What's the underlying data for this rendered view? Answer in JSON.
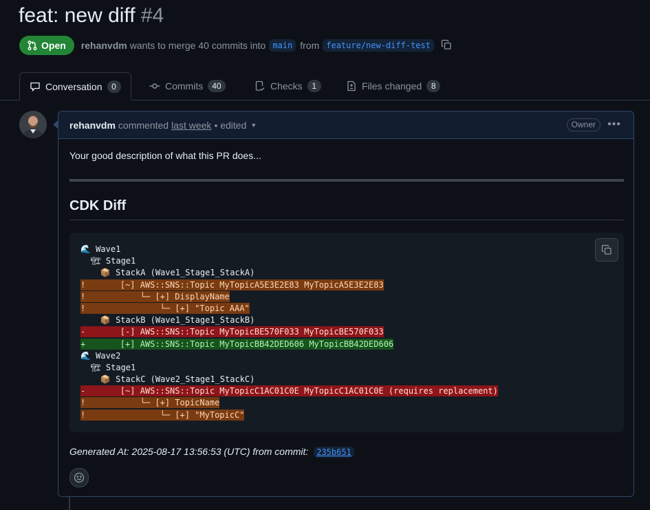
{
  "pr": {
    "title": "feat: new diff",
    "number": "#4",
    "state": "Open",
    "author": "rehanvdm",
    "merge_text": "wants to merge 40 commits into",
    "base_branch": "main",
    "from_text": "from",
    "head_branch": "feature/new-diff-test"
  },
  "tabs": [
    {
      "label": "Conversation",
      "count": "0",
      "icon": "comment-icon"
    },
    {
      "label": "Commits",
      "count": "40",
      "icon": "commit-icon"
    },
    {
      "label": "Checks",
      "count": "1",
      "icon": "checklist-icon"
    },
    {
      "label": "Files changed",
      "count": "8",
      "icon": "file-diff-icon"
    }
  ],
  "comment": {
    "author": "rehanvdm",
    "action": "commented",
    "when": "last week",
    "edited": "• edited",
    "role": "Owner",
    "description": "Your good description of what this PR does...",
    "heading": "CDK Diff",
    "code_lines": [
      {
        "text": "🌊 Wave1",
        "type": "plain"
      },
      {
        "text": "  🏗 Stage1",
        "type": "plain"
      },
      {
        "text": "    📦 StackA (Wave1_Stage1_StackA)",
        "type": "plain"
      },
      {
        "text": "!       [~] AWS::SNS::Topic MyTopicA5E3E2E83 MyTopicA5E3E2E83",
        "type": "warn"
      },
      {
        "text": "!           └─ [+] DisplayName",
        "type": "warn"
      },
      {
        "text": "!               └─ [+] \"Topic AAA\"",
        "type": "warn"
      },
      {
        "text": "    📦 StackB (Wave1_Stage1_StackB)",
        "type": "plain"
      },
      {
        "text": "-       [-] AWS::SNS::Topic MyTopicBE570F033 MyTopicBE570F033",
        "type": "red"
      },
      {
        "text": "+       [+] AWS::SNS::Topic MyTopicBB42DED606 MyTopicBB42DED606",
        "type": "green"
      },
      {
        "text": "🌊 Wave2",
        "type": "plain"
      },
      {
        "text": "  🏗 Stage1",
        "type": "plain"
      },
      {
        "text": "    📦 StackC (Wave2_Stage1_StackC)",
        "type": "plain"
      },
      {
        "text": "-       [~] AWS::SNS::Topic MyTopicC1AC01C0E MyTopicC1AC01C0E (requires replacement)",
        "type": "red"
      },
      {
        "text": "!           └─ [+] TopicName",
        "type": "warn"
      },
      {
        "text": "!               └─ [+] \"MyTopicC\"",
        "type": "warn"
      }
    ],
    "generated_text": "Generated At: 2025-08-17 13:56:53 (UTC) from commit:",
    "commit_sha": "235b651"
  },
  "colors": {
    "open_badge": "#238636",
    "link": "#4493f8",
    "warn_bg": "#7a3b11",
    "removed_bg": "#8e1519",
    "added_bg": "#17531c"
  }
}
